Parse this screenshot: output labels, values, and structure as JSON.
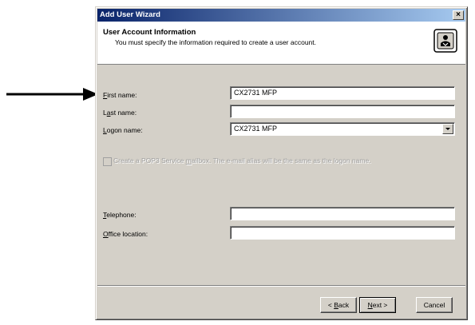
{
  "window": {
    "title": "Add User Wizard",
    "close_glyph": "×"
  },
  "header": {
    "title": "User Account Information",
    "subtitle": "You must specify the information required to create a user account.",
    "icon": "user-account-wizard-icon"
  },
  "form": {
    "first_name_label_key": "F",
    "first_name_label_rest": "irst name:",
    "first_name_value": "CX2731 MFP",
    "last_name_label_pre": "L",
    "last_name_label_key": "a",
    "last_name_label_rest": "st name:",
    "last_name_value": "",
    "logon_name_label_key": "L",
    "logon_name_label_rest": "ogon name:",
    "logon_name_value": "CX2731 MFP",
    "mailbox_text_pre": "Create a POP3 Service ",
    "mailbox_text_key": "m",
    "mailbox_text_rest": "ailbox. The e-mail alias will be the same as the logon name.",
    "telephone_label_key": "T",
    "telephone_label_rest": "elephone:",
    "telephone_value": "",
    "office_label_key": "O",
    "office_label_rest": "ffice location:",
    "office_value": ""
  },
  "buttons": {
    "back_pre": "< ",
    "back_key": "B",
    "back_rest": "ack",
    "next_key": "N",
    "next_rest": "ext >",
    "cancel": "Cancel"
  },
  "colors": {
    "titlebar_start": "#0a246a",
    "titlebar_end": "#a6caf0",
    "dialog_bg": "#d4d0c8"
  }
}
